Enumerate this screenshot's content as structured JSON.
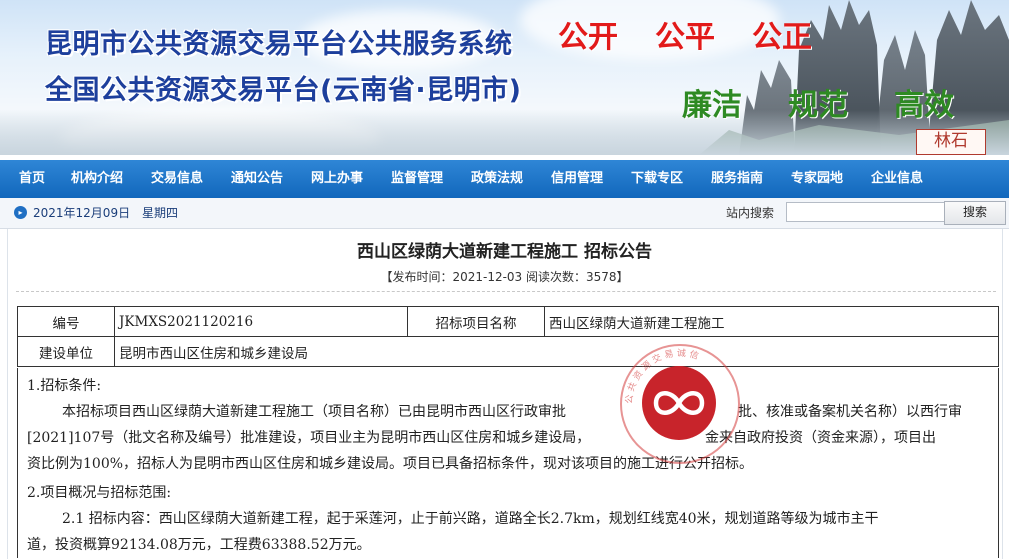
{
  "banner": {
    "title_line1": "昆明市公共资源交易平台公共服务系统",
    "title_line2": "全国公共资源交易平台(云南省·昆明市)",
    "slogan_red": [
      "公开",
      "公平",
      "公正"
    ],
    "slogan_green": [
      "廉洁",
      "规范",
      "高效"
    ],
    "seal_text": "林石"
  },
  "nav": {
    "items": [
      "首页",
      "机构介绍",
      "交易信息",
      "通知公告",
      "网上办事",
      "监督管理",
      "政策法规",
      "信用管理",
      "下载专区",
      "服务指南",
      "专家园地",
      "企业信息"
    ]
  },
  "infobar": {
    "date": "2021年12月09日",
    "weekday": "星期四",
    "search_label": "站内搜索",
    "search_value": "",
    "search_button": "搜索"
  },
  "article": {
    "title": "西山区绿荫大道新建工程施工  招标公告",
    "meta": "【发布时间：2021-12-03  阅读次数：3578】",
    "table": {
      "row1": {
        "label1": "编号",
        "value1": "JKMXS2021120216",
        "label2": "招标项目名称",
        "value2": "西山区绿荫大道新建工程施工"
      },
      "row2": {
        "label1": "建设单位",
        "value1": "昆明市西山区住房和城乡建设局"
      }
    },
    "section1_heading": "1.招标条件:",
    "section1_line1": "本招标项目西山区绿荫大道新建工程施工（项目名称）已由昆明市西山区行政审批",
    "section1_line1_tail": "批、核准或备案机关名称）以西行审",
    "section1_line2": "[2021]107号（批文名称及编号）批准建设，项目业主为昆明市西山区住房和城乡建设局，",
    "section1_line2_tail": "金来自政府投资（资金来源），项目出",
    "section1_line3": "资比例为100%，招标人为昆明市西山区住房和城乡建设局。项目已具备招标条件，现对该项目的施工进行公开招标。",
    "section2_heading": "2.项目概况与招标范围:",
    "section2_line1": "2.1 招标内容：西山区绿荫大道新建工程，起于采莲河，止于前兴路，道路全长2.7km，规划红线宽40米，规划道路等级为城市主干",
    "section2_line2": "道，投资概算92134.08万元，工程费63388.52万元。"
  },
  "watermark": {
    "ring_text": "公共资源交易诚信",
    "color": "#c8242b"
  }
}
